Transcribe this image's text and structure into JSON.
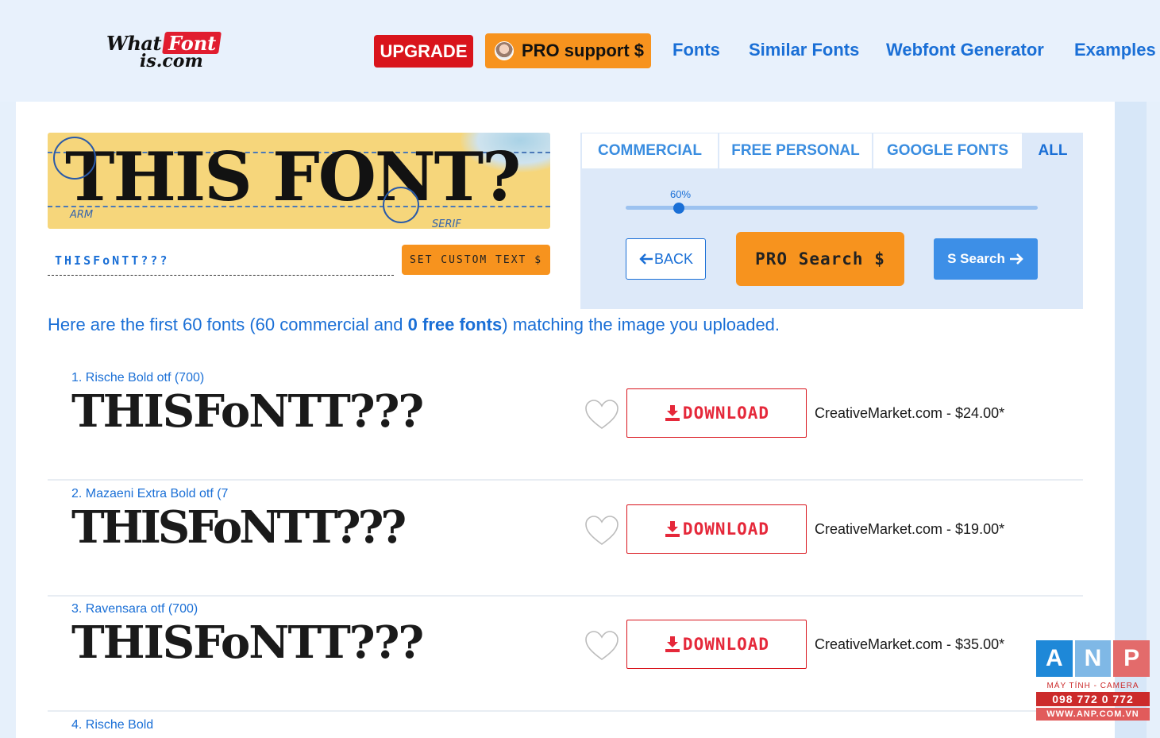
{
  "header": {
    "logo": {
      "what": "What",
      "font": "Font",
      "iscom": "is.com"
    },
    "upgrade_label": "UPGRADE",
    "pro_support_label": "PRO support $",
    "nav": [
      "Fonts",
      "Similar Fonts",
      "Webfont Generator",
      "Examples"
    ]
  },
  "upload": {
    "banner_text": "THIS FONT?",
    "annotation_arm": "ARM",
    "annotation_serif": "SERIF",
    "custom_text_value": "THISFoNTT???",
    "set_custom_text_label": "SET CUSTOM TEXT $"
  },
  "filter": {
    "tabs": [
      "COMMERCIAL",
      "FREE PERSONAL",
      "GOOGLE FONTS",
      "ALL"
    ],
    "active_tab": "ALL",
    "slider_label": "60%",
    "slider_value": 0.6,
    "back_label": "BACK",
    "pro_search_label": "PRO Search $",
    "s_search_label": "S Search"
  },
  "summary": {
    "prefix": "Here are the first 60 fonts (60 commercial and ",
    "free_count": "0 free fonts",
    "suffix": ") matching the image you uploaded."
  },
  "results": [
    {
      "name": "1. Rische Bold otf (700)",
      "sample": "THISFoNTT???",
      "download_label": "DOWNLOAD",
      "price": "CreativeMarket.com - $24.00*"
    },
    {
      "name": "2. Mazaeni Extra Bold otf (7",
      "sample": "THISFoNTT???",
      "download_label": "DOWNLOAD",
      "price": "CreativeMarket.com - $19.00*"
    },
    {
      "name": "3. Ravensara otf (700)",
      "sample": "THISFoNTT???",
      "download_label": "DOWNLOAD",
      "price": "CreativeMarket.com - $35.00*"
    },
    {
      "name": "4. Rische Bold"
    }
  ],
  "watermark": {
    "letters": [
      "A",
      "N",
      "P"
    ],
    "tagline": "MÁY TÍNH - CAMERA",
    "phone": "098 772 0 772",
    "site": "WWW.ANP.COM.VN"
  },
  "colors": {
    "accent_blue": "#1a6fd6",
    "upgrade_red": "#d9141c",
    "orange": "#f7931e",
    "download_red": "#e5283a"
  }
}
